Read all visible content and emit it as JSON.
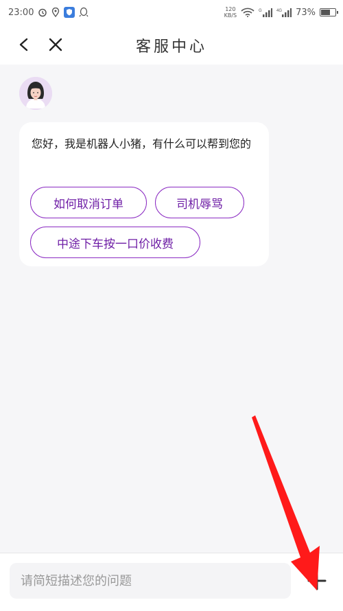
{
  "status_bar": {
    "time": "23:00",
    "net_speed_value": "120",
    "net_speed_unit": "KB/S",
    "battery_percent": "73%",
    "battery_level": 0.73,
    "icons": [
      "alarm-icon",
      "location-icon",
      "shield-app-icon",
      "qq-icon",
      "wifi-icon",
      "signal-icon",
      "signal-4g-icon",
      "battery-icon"
    ]
  },
  "header": {
    "title": "客服中心",
    "back_icon": "chevron-left-icon",
    "close_icon": "close-icon"
  },
  "chat": {
    "bot_message": "您好，我是机器人小猪，有什么可以帮到您的",
    "quick_replies": [
      "如何取消订单",
      "司机辱骂",
      "中途下车按一口价收费"
    ]
  },
  "input_bar": {
    "placeholder": "请简短描述您的问题",
    "plus_icon": "plus-icon"
  },
  "colors": {
    "accent": "#8a2ac2",
    "background": "#f6f6f8",
    "annotation": "#ff1a1a"
  }
}
